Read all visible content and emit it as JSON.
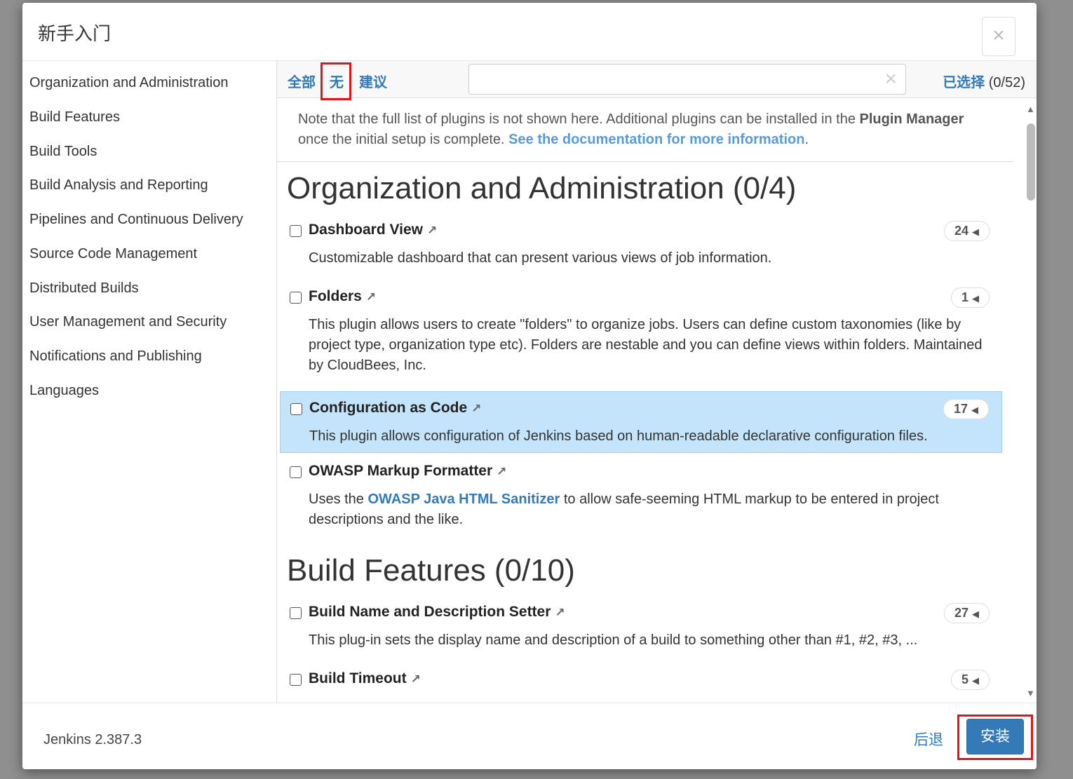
{
  "dialog": {
    "title": "新手入门",
    "close_label": "×"
  },
  "sidebar": {
    "items": [
      {
        "label": "Organization and Administration"
      },
      {
        "label": "Build Features"
      },
      {
        "label": "Build Tools"
      },
      {
        "label": "Build Analysis and Reporting"
      },
      {
        "label": "Pipelines and Continuous Delivery"
      },
      {
        "label": "Source Code Management"
      },
      {
        "label": "Distributed Builds"
      },
      {
        "label": "User Management and Security"
      },
      {
        "label": "Notifications and Publishing"
      },
      {
        "label": "Languages"
      }
    ]
  },
  "toolbar": {
    "all_label": "全部",
    "separator": "|",
    "none_label": "无",
    "suggested_label": "建议",
    "search_value": "",
    "search_clear": "×",
    "selected_label": "已选择",
    "selected_count": "(0/52)"
  },
  "note": {
    "text_1": "Note that the full list of plugins is not shown here. Additional plugins can be installed in the ",
    "bold": "Plugin Manager",
    "text_2": " once the initial setup is complete. ",
    "link": "See the documentation for more information",
    "text_3": "."
  },
  "sections": [
    {
      "title": "Organization and Administration (0/4)",
      "plugins": [
        {
          "name": "Dashboard View",
          "ext": "↗",
          "count": "24",
          "desc": "Customizable dashboard that can present various views of job information."
        },
        {
          "name": "Folders",
          "ext": "↗",
          "count": "1",
          "desc": "This plugin allows users to create \"folders\" to organize jobs. Users can define custom taxonomies (like by project type, organization type etc). Folders are nestable and you can define views within folders. Maintained by CloudBees, Inc."
        },
        {
          "name": "Configuration as Code",
          "ext": "↗",
          "count": "17",
          "desc": "This plugin allows configuration of Jenkins based on human-readable declarative configuration files."
        },
        {
          "name": "OWASP Markup Formatter",
          "ext": "↗",
          "desc_pre": "Uses the ",
          "desc_link": "OWASP Java HTML Sanitizer",
          "desc_post": " to allow safe-seeming HTML markup to be entered in project descriptions and the like."
        }
      ]
    },
    {
      "title": "Build Features (0/10)",
      "plugins": [
        {
          "name": "Build Name and Description Setter",
          "ext": "↗",
          "count": "27",
          "desc": "This plug-in sets the display name and description of a build to something other than #1, #2, #3, ..."
        },
        {
          "name": "Build Timeout",
          "ext": "↗",
          "count": "5"
        }
      ]
    }
  ],
  "footer": {
    "version": "Jenkins 2.387.3",
    "back_label": "后退",
    "install_label": "安装"
  },
  "colors": {
    "link": "#337ab7",
    "highlight_row": "#c3e4fb",
    "annotation": "#e0141a"
  }
}
